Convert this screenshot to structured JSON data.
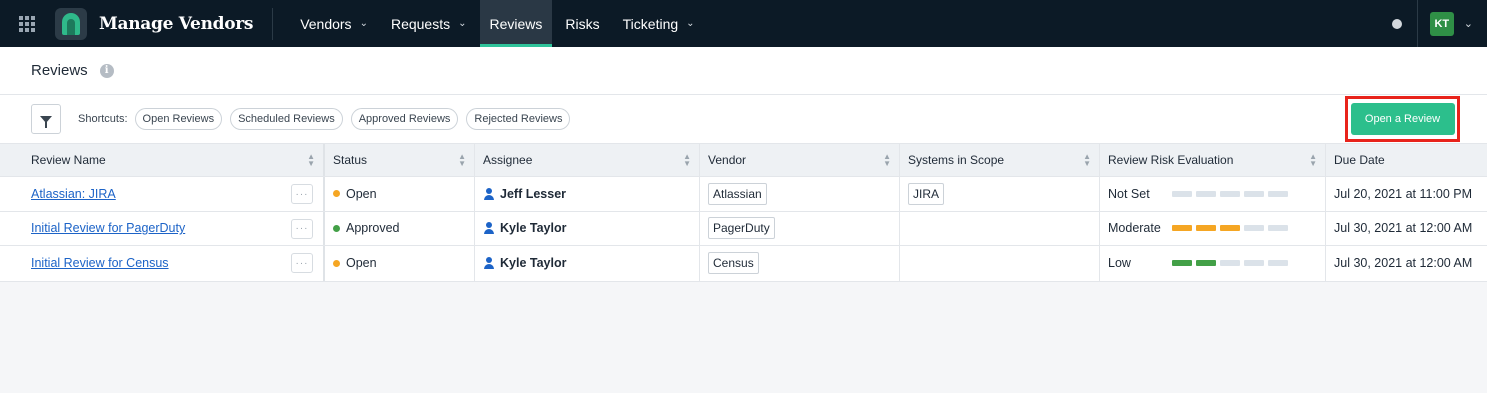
{
  "app": {
    "title": "Manage Vendors",
    "user_initials": "KT"
  },
  "nav": {
    "items": [
      {
        "label": "Vendors",
        "has_menu": true,
        "active": false
      },
      {
        "label": "Requests",
        "has_menu": true,
        "active": false
      },
      {
        "label": "Reviews",
        "has_menu": false,
        "active": true
      },
      {
        "label": "Risks",
        "has_menu": false,
        "active": false
      },
      {
        "label": "Ticketing",
        "has_menu": true,
        "active": false
      }
    ]
  },
  "page": {
    "title": "Reviews"
  },
  "toolbar": {
    "shortcuts_label": "Shortcuts:",
    "shortcuts": [
      "Open Reviews",
      "Scheduled Reviews",
      "Approved Reviews",
      "Rejected Reviews"
    ],
    "open_review_label": "Open a Review"
  },
  "table": {
    "columns": [
      "Review Name",
      "Status",
      "Assignee",
      "Vendor",
      "Systems in Scope",
      "Review Risk Evaluation",
      "Due Date"
    ],
    "rows": [
      {
        "name": "Atlassian: JIRA",
        "status": "Open",
        "status_color": "#f5a623",
        "assignee": "Jeff Lesser",
        "vendor": "Atlassian",
        "systems": "JIRA",
        "risk": "Not Set",
        "risk_level": 0,
        "risk_color": "#dbe2e9",
        "due": "Jul 20, 2021 at 11:00 PM"
      },
      {
        "name": "Initial Review for PagerDuty",
        "status": "Approved",
        "status_color": "#43a047",
        "assignee": "Kyle Taylor",
        "vendor": "PagerDuty",
        "systems": "",
        "risk": "Moderate",
        "risk_level": 3,
        "risk_color": "#f5a623",
        "due": "Jul 30, 2021 at 12:00 AM"
      },
      {
        "name": "Initial Review for Census",
        "status": "Open",
        "status_color": "#f5a623",
        "assignee": "Kyle Taylor",
        "vendor": "Census",
        "systems": "",
        "risk": "Low",
        "risk_level": 2,
        "risk_color": "#43a047",
        "due": "Jul 30, 2021 at 12:00 AM"
      }
    ]
  }
}
